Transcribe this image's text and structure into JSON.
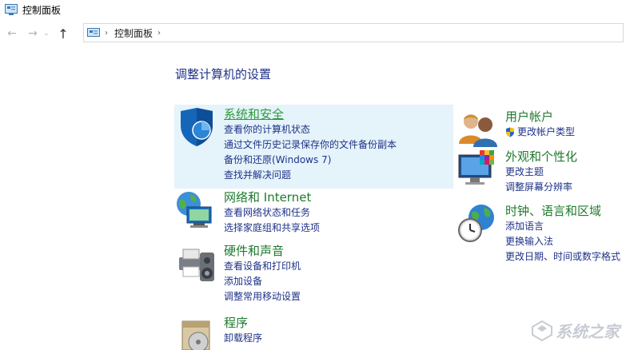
{
  "window": {
    "title": "控制面板"
  },
  "nav": {
    "back_icon": "←",
    "forward_icon": "→",
    "dropdown_icon": "⌄",
    "up_icon": "↑",
    "breadcrumb_sep": "›",
    "breadcrumb": "控制面板",
    "end_sep": "›"
  },
  "page": {
    "title": "调整计算机的设置"
  },
  "categories": {
    "system_security": {
      "title": "系统和安全",
      "links": [
        "查看你的计算机状态",
        "通过文件历史记录保存你的文件备份副本",
        "备份和还原(Windows 7)",
        "查找并解决问题"
      ]
    },
    "network": {
      "title": "网络和 Internet",
      "links": [
        "查看网络状态和任务",
        "选择家庭组和共享选项"
      ]
    },
    "hardware": {
      "title": "硬件和声音",
      "links": [
        "查看设备和打印机",
        "添加设备",
        "调整常用移动设置"
      ]
    },
    "programs": {
      "title": "程序",
      "links": [
        "卸载程序"
      ]
    },
    "user_accounts": {
      "title": "用户帐户",
      "links": [
        "更改帐户类型"
      ]
    },
    "appearance": {
      "title": "外观和个性化",
      "links": [
        "更改主题",
        "调整屏幕分辨率"
      ]
    },
    "clock_region": {
      "title": "时钟、语言和区域",
      "links": [
        "添加语言",
        "更换输入法",
        "更改日期、时间或数字格式"
      ]
    }
  },
  "watermark": {
    "text": "系统之家"
  }
}
